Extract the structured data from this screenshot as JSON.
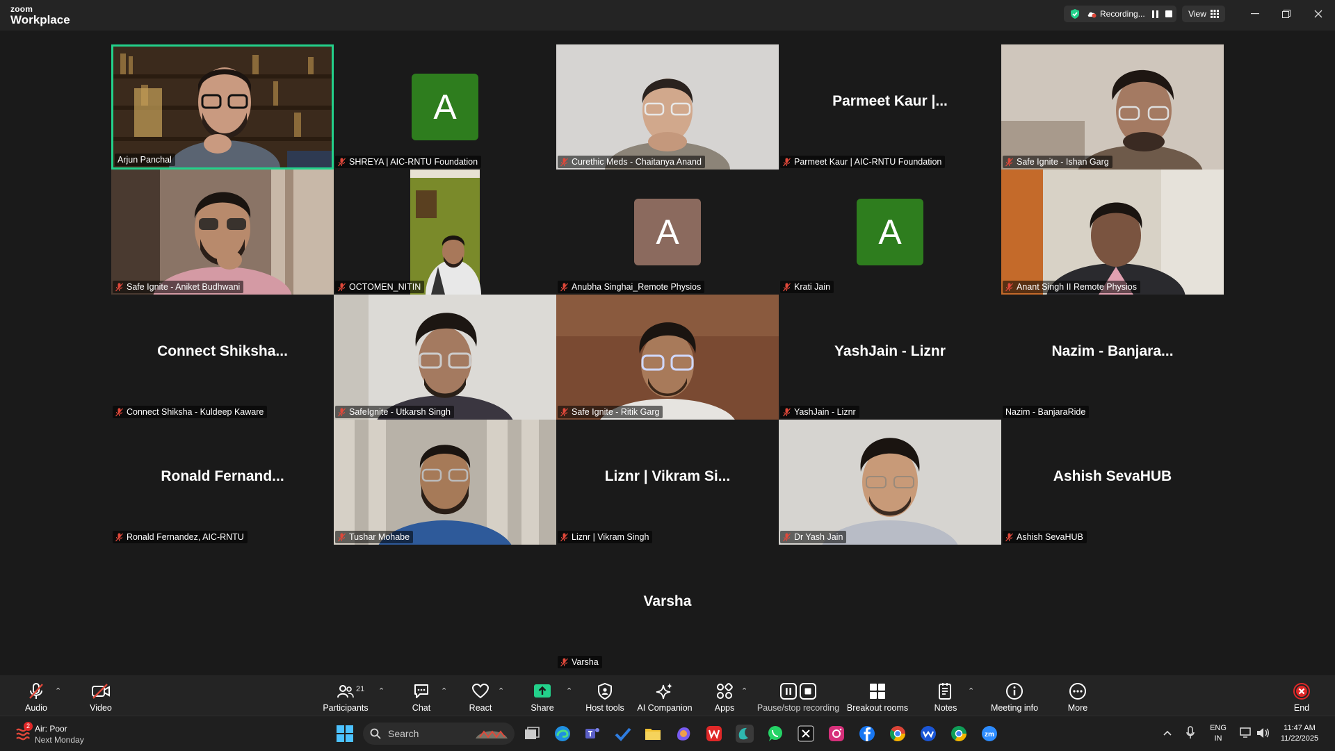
{
  "app": {
    "brand_small": "zoom",
    "brand_big": "Workplace"
  },
  "titlebar": {
    "recording_label": "Recording...",
    "view_label": "View"
  },
  "participants": [
    {
      "name": "Arjun Panchal",
      "display": "",
      "avatar_letter": "",
      "muted": false
    },
    {
      "name": "SHREYA | AIC-RNTU Foundation",
      "display": "",
      "avatar_letter": "A",
      "muted": true
    },
    {
      "name": "Curethic Meds - Chaitanya Anand",
      "display": "",
      "avatar_letter": "",
      "muted": true
    },
    {
      "name": "Parmeet Kaur | AIC-RNTU Foundation",
      "display": "Parmeet Kaur |...",
      "avatar_letter": "",
      "muted": true
    },
    {
      "name": "Safe Ignite - Ishan Garg",
      "display": "",
      "avatar_letter": "",
      "muted": true
    },
    {
      "name": "Safe Ignite - Aniket Budhwani",
      "display": "",
      "avatar_letter": "",
      "muted": true
    },
    {
      "name": "OCTOMEN_NITIN",
      "display": "",
      "avatar_letter": "",
      "muted": true
    },
    {
      "name": "Anubha Singhai_Remote Physios",
      "display": "",
      "avatar_letter": "A",
      "muted": true
    },
    {
      "name": "Krati Jain",
      "display": "",
      "avatar_letter": "A",
      "muted": true
    },
    {
      "name": "Anant Singh II Remote Physios",
      "display": "",
      "avatar_letter": "",
      "muted": true
    },
    {
      "name": "Connect Shiksha - Kuldeep Kaware",
      "display": "Connect  Shiksha...",
      "avatar_letter": "",
      "muted": true
    },
    {
      "name": "SafeIgnite - Utkarsh Singh",
      "display": "",
      "avatar_letter": "",
      "muted": true
    },
    {
      "name": "Safe Ignite - Ritik Garg",
      "display": "",
      "avatar_letter": "",
      "muted": true
    },
    {
      "name": "YashJain - Liznr",
      "display": "YashJain - Liznr",
      "avatar_letter": "",
      "muted": true
    },
    {
      "name": "Nazim - BanjaraRide",
      "display": "Nazim  - Banjara...",
      "avatar_letter": "",
      "muted": false
    },
    {
      "name": "Ronald Fernandez, AIC-RNTU",
      "display": "Ronald  Fernand...",
      "avatar_letter": "",
      "muted": true
    },
    {
      "name": "Tushar Mohabe",
      "display": "",
      "avatar_letter": "",
      "muted": true
    },
    {
      "name": "Liznr | Vikram Singh",
      "display": "Liznr | Vikram Si...",
      "avatar_letter": "",
      "muted": true
    },
    {
      "name": "Dr Yash Jain",
      "display": "",
      "avatar_letter": "",
      "muted": true
    },
    {
      "name": "Ashish SevaHUB",
      "display": "Ashish SevaHUB",
      "avatar_letter": "",
      "muted": true
    },
    {
      "name": "Varsha",
      "display": "Varsha",
      "avatar_letter": "",
      "muted": true
    }
  ],
  "toolbar": {
    "audio": "Audio",
    "video": "Video",
    "participants": "Participants",
    "participants_count": "21",
    "chat": "Chat",
    "react": "React",
    "share": "Share",
    "host_tools": "Host tools",
    "ai_companion": "AI Companion",
    "apps": "Apps",
    "pause_stop_recording": "Pause/stop recording",
    "breakout_rooms": "Breakout rooms",
    "notes": "Notes",
    "meeting_info": "Meeting info",
    "more": "More",
    "end": "End"
  },
  "taskbar": {
    "weather_badge": "2",
    "weather_line1": "Air: Poor",
    "weather_line2": "Next Monday",
    "search_placeholder": "Search",
    "lang_line1": "ENG",
    "lang_line2": "IN",
    "time": "11:47 AM",
    "date": "11/22/2025"
  },
  "colors": {
    "active_speaker_border": "#23d18b",
    "avatar_green": "#2e7d1e",
    "avatar_brown": "#8b6a5e",
    "share_green": "#23d18b",
    "end_red": "#e02828",
    "muted_red": "#e0483a"
  }
}
